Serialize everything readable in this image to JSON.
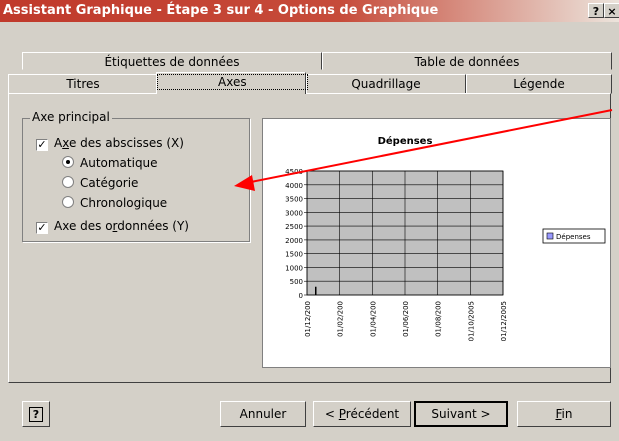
{
  "window": {
    "title": "Assistant Graphique - Étape 3 sur 4 - Options de Graphique",
    "help_label": "?",
    "close_label": "×"
  },
  "tabs": {
    "row1": [
      {
        "label": "Étiquettes de données"
      },
      {
        "label": "Table de données"
      }
    ],
    "row2": [
      {
        "label": "Titres"
      },
      {
        "label": "Axes",
        "active": true
      },
      {
        "label": "Quadrillage"
      },
      {
        "label": "Légende"
      }
    ]
  },
  "axes_panel": {
    "group_title": "Axe principal",
    "x_axis": {
      "label_pre": "A",
      "label_accel": "x",
      "label_post": "e des abscisses (X)",
      "checked": true,
      "checkmark": "✓"
    },
    "x_options": [
      {
        "label": "Automatique",
        "selected": true
      },
      {
        "label": "Catégorie",
        "selected": false
      },
      {
        "label": "Chronologique",
        "selected": false
      }
    ],
    "y_axis": {
      "label_pre": "Axe des o",
      "label_accel": "r",
      "label_post": "données (Y)",
      "checked": true,
      "checkmark": "✓"
    }
  },
  "chart_data": {
    "type": "bar",
    "title": "Dépenses",
    "legend": "Dépenses",
    "legend_position": "right",
    "ylim": [
      0,
      4500
    ],
    "yticks": [
      "0",
      "500",
      "1000",
      "1500",
      "2000",
      "2500",
      "3000",
      "3500",
      "4000",
      "4500"
    ],
    "categories": [
      "01/12/200",
      "01/02/200",
      "01/04/200",
      "01/06/200",
      "01/08/200",
      "01/10/2005",
      "01/12/2005"
    ],
    "values": [
      300,
      0,
      0,
      0,
      0,
      0,
      0
    ],
    "grid": true
  },
  "buttons": {
    "help_icon_label": "?",
    "cancel": "Annuler",
    "prev_accel": "P",
    "prev_pre": "< ",
    "prev_post": "récédent",
    "next": "Suivant >",
    "finish_accel": "F",
    "finish_post": "in"
  },
  "colors": {
    "titlebar": "#c0392b",
    "arrow": "#ff0000",
    "plot_bg": "#c0c0c0",
    "dialog_bg": "#d4d0c8"
  }
}
